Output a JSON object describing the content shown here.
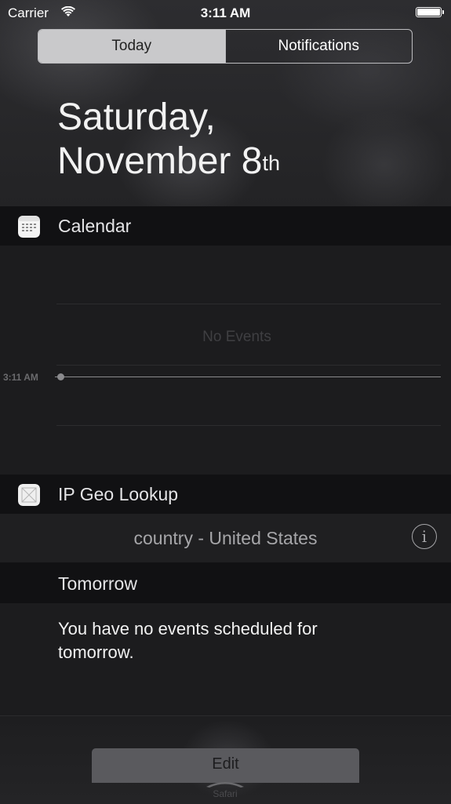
{
  "status_bar": {
    "carrier": "Carrier",
    "time": "3:11 AM",
    "wifi_icon": "wifi-icon",
    "battery_icon": "battery-icon"
  },
  "segmented_control": {
    "today": "Today",
    "notifications": "Notifications",
    "selected": "Today"
  },
  "date_heading": {
    "line1": "Saturday,",
    "line2": "November 8",
    "suffix": "th"
  },
  "calendar": {
    "title": "Calendar",
    "icon": "calendar-icon",
    "no_events": "No Events",
    "now_time": "3:11 AM"
  },
  "ip_geo": {
    "title": "IP Geo Lookup",
    "icon": "ip-geo-icon",
    "value": "country - United States",
    "info_icon": "info-icon"
  },
  "tomorrow": {
    "title": "Tomorrow",
    "message": "You have no events scheduled for tomorrow."
  },
  "footer": {
    "edit": "Edit",
    "dock_label": "Safari"
  },
  "colors": {
    "background": "#1a1a1c",
    "header_bar": "#111113",
    "segment_active": "#c9c9cb",
    "text_primary": "#f2f2f2",
    "text_secondary": "#a6a6a9"
  }
}
